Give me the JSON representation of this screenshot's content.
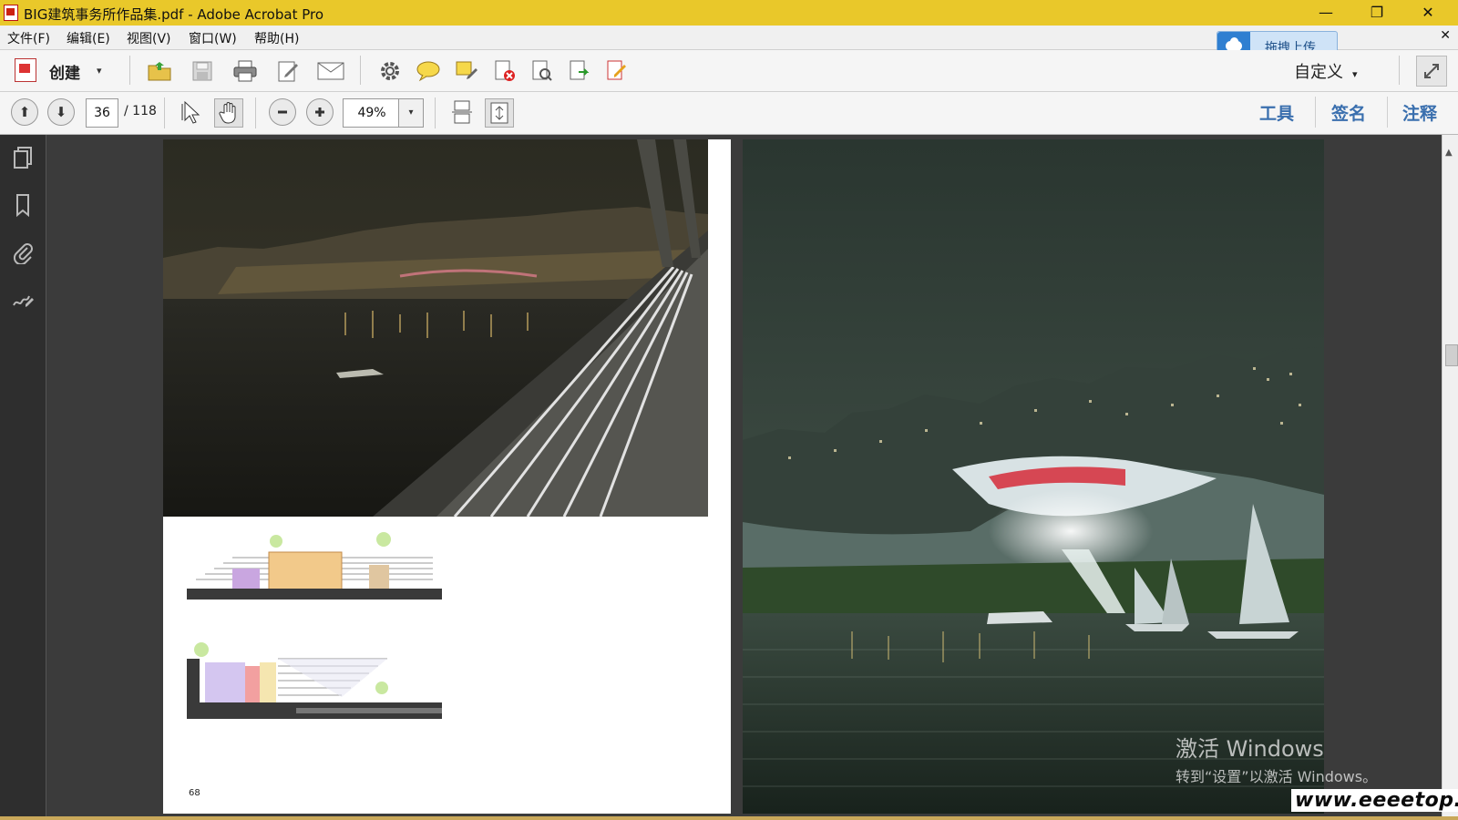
{
  "window": {
    "title": "BIG建筑事务所作品集.pdf - Adobe Acrobat Pro",
    "minimize_glyph": "—",
    "restore_glyph": "❐",
    "close_glyph": "✕"
  },
  "menu": {
    "items": [
      "文件(F)",
      "编辑(E)",
      "视图(V)",
      "窗口(W)",
      "帮助(H)"
    ],
    "close_glyph": "✕"
  },
  "upload_widget": {
    "label": "拖拽上传",
    "icon": "cloud-icon"
  },
  "toolbar": {
    "create_label": "创建",
    "create_arrow": "▾",
    "customize_label": "自定义",
    "customize_arrow": "▾",
    "icons": [
      "open-folder-icon",
      "save-icon",
      "print-icon",
      "edit-icon",
      "email-icon",
      "gear-icon",
      "comment-icon",
      "highlight-icon",
      "delete-page-icon",
      "pages-icon",
      "export-icon",
      "sign-doc-icon",
      "expand-icon"
    ]
  },
  "navigation": {
    "current_page": "36",
    "total_pages": "/ 118",
    "zoom": "49%",
    "zoom_arrow": "▾",
    "prev_glyph": "⬆",
    "next_glyph": "⬇"
  },
  "right_panels": {
    "tools": "工具",
    "sign": "签名",
    "comment": "注释"
  },
  "document": {
    "page_number": "68"
  },
  "watermark": {
    "activate_title": "激活 Windows",
    "activate_hint": "转到“设置”以激活 Windows。",
    "site": "www.eeeetop.com"
  },
  "colors": {
    "title_bar": "#e9c82a",
    "panel_link": "#3a6fae",
    "doc_background": "#3b3b3b"
  }
}
